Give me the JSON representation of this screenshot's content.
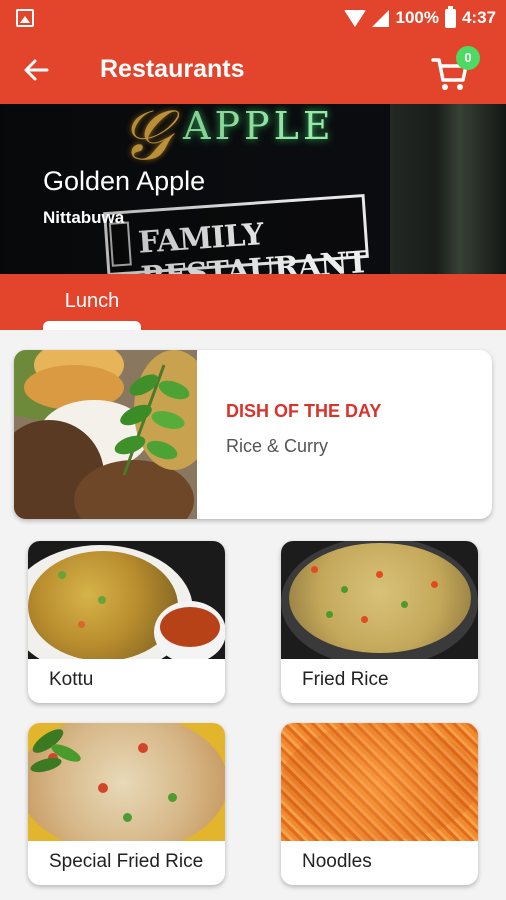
{
  "status_bar": {
    "battery": "100%",
    "time": "4:37"
  },
  "app_bar": {
    "title": "Restaurants",
    "cart_count": "0"
  },
  "restaurant": {
    "name": "Golden Apple",
    "location": "Nittabuwa"
  },
  "tabs": [
    {
      "label": "Lunch",
      "selected": true
    }
  ],
  "dish_of_the_day": {
    "label": "DISH OF THE DAY",
    "name": "Rice & Curry"
  },
  "menu_items": [
    {
      "name": "Kottu"
    },
    {
      "name": "Fried Rice"
    },
    {
      "name": "Special Fried Rice"
    },
    {
      "name": "Noodles"
    }
  ],
  "colors": {
    "primary": "#e2442c",
    "accent_text": "#d9332b",
    "badge": "#4cd964"
  }
}
